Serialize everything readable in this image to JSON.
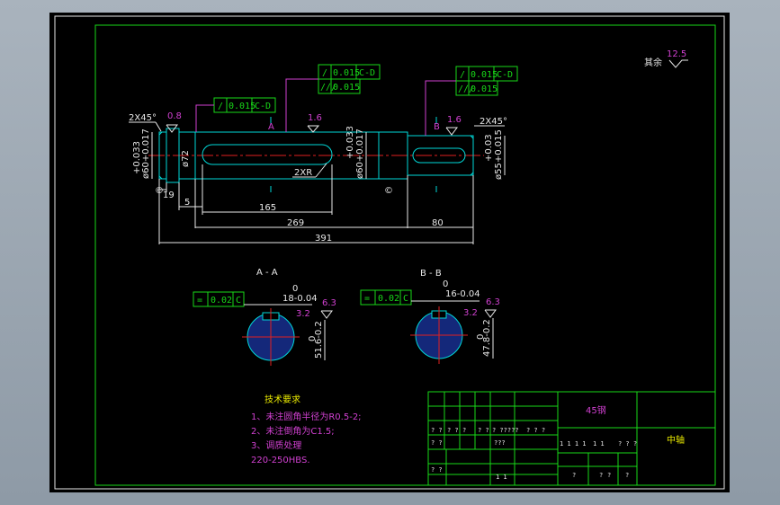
{
  "colors": {
    "bg": "#000000",
    "green": "#18d818",
    "white": "#e8e8e8",
    "cyan": "#00d8d8",
    "magenta": "#d040d0",
    "red": "#e02020",
    "yellow": "#e8e800",
    "section_fill": "#14287a"
  },
  "roughness": {
    "rest_label": "其余",
    "rest_value": "12.5"
  },
  "frames": {
    "fcf1": {
      "sym": "/",
      "tol": "0.015",
      "datum": "C-D"
    },
    "fcf2": {
      "sym": "/",
      "tol": "0.015",
      "datum": "C-D",
      "sym2": "/∕/",
      "tol2": "0.015"
    },
    "fcf3": {
      "sym": "/",
      "tol": "0.015",
      "datum": "C-D",
      "sym2": "/∕/",
      "tol2": "0.015"
    },
    "fcfA": {
      "sym": "=",
      "tol": "0.02",
      "datum": "C"
    },
    "fcfB": {
      "sym": "=",
      "tol": "0.02",
      "datum": "C"
    }
  },
  "dims": {
    "chamfer_left": "2X45°",
    "chamfer_right": "2X45°",
    "ra_left": "0.8",
    "ra_mid": "1.6",
    "ra_right": "1.6",
    "d_left": "ø60+0.033+0.017",
    "d72": "ø72",
    "d_mid": "ø60+0.033+0.017",
    "d_right": "ø55+0.03+0.015",
    "d_left_a": "+0.033",
    "d_left_b": "ø60+0.017",
    "d_mid_a": "+0.033",
    "d_mid_b": "ø60+0.017",
    "d_right_a": "+0.03",
    "d_right_b": "ø55+0.015",
    "radius": "2XR",
    "len19": "19",
    "len5": "5",
    "len165": "165",
    "len269": "269",
    "len80": "80",
    "len391": "391",
    "sec_a_mark": "A",
    "sec_b_mark": "B",
    "datum_c": "C",
    "datum_d": "D",
    "datum_c_mark": "©"
  },
  "sections": {
    "a": {
      "title": "A - A",
      "width": "18-0.04",
      "width_top": "0",
      "depth": "51.6-0.2",
      "depth_top": "0",
      "ra_top": "6.3",
      "ra_side": "3.2"
    },
    "b": {
      "title": "B - B",
      "width": "16-0.04",
      "width_top": "0",
      "depth": "47.8-0.2",
      "depth_top": "0",
      "ra_top": "6.3",
      "ra_side": "3.2"
    }
  },
  "notes": {
    "title": "技术要求",
    "l1": "1、未注圆角半径为R0.5-2;",
    "l2": "2、未注倒角为C1.5;",
    "l3": "3、调质处理",
    "l4": "220-250HBS."
  },
  "titleblock": {
    "material": "45钢",
    "name": "中轴",
    "row1": [
      "? ?",
      "? ?",
      "?",
      "? ?",
      "? ?????",
      "? ? ?"
    ],
    "row2": [
      "? ?",
      "???"
    ],
    "row3": [
      "1 1 1 1",
      "1 1",
      "? ? ?"
    ],
    "row4": [
      "? ?",
      "1 1"
    ],
    "row5": [
      "?",
      "?",
      "?",
      "?"
    ]
  }
}
